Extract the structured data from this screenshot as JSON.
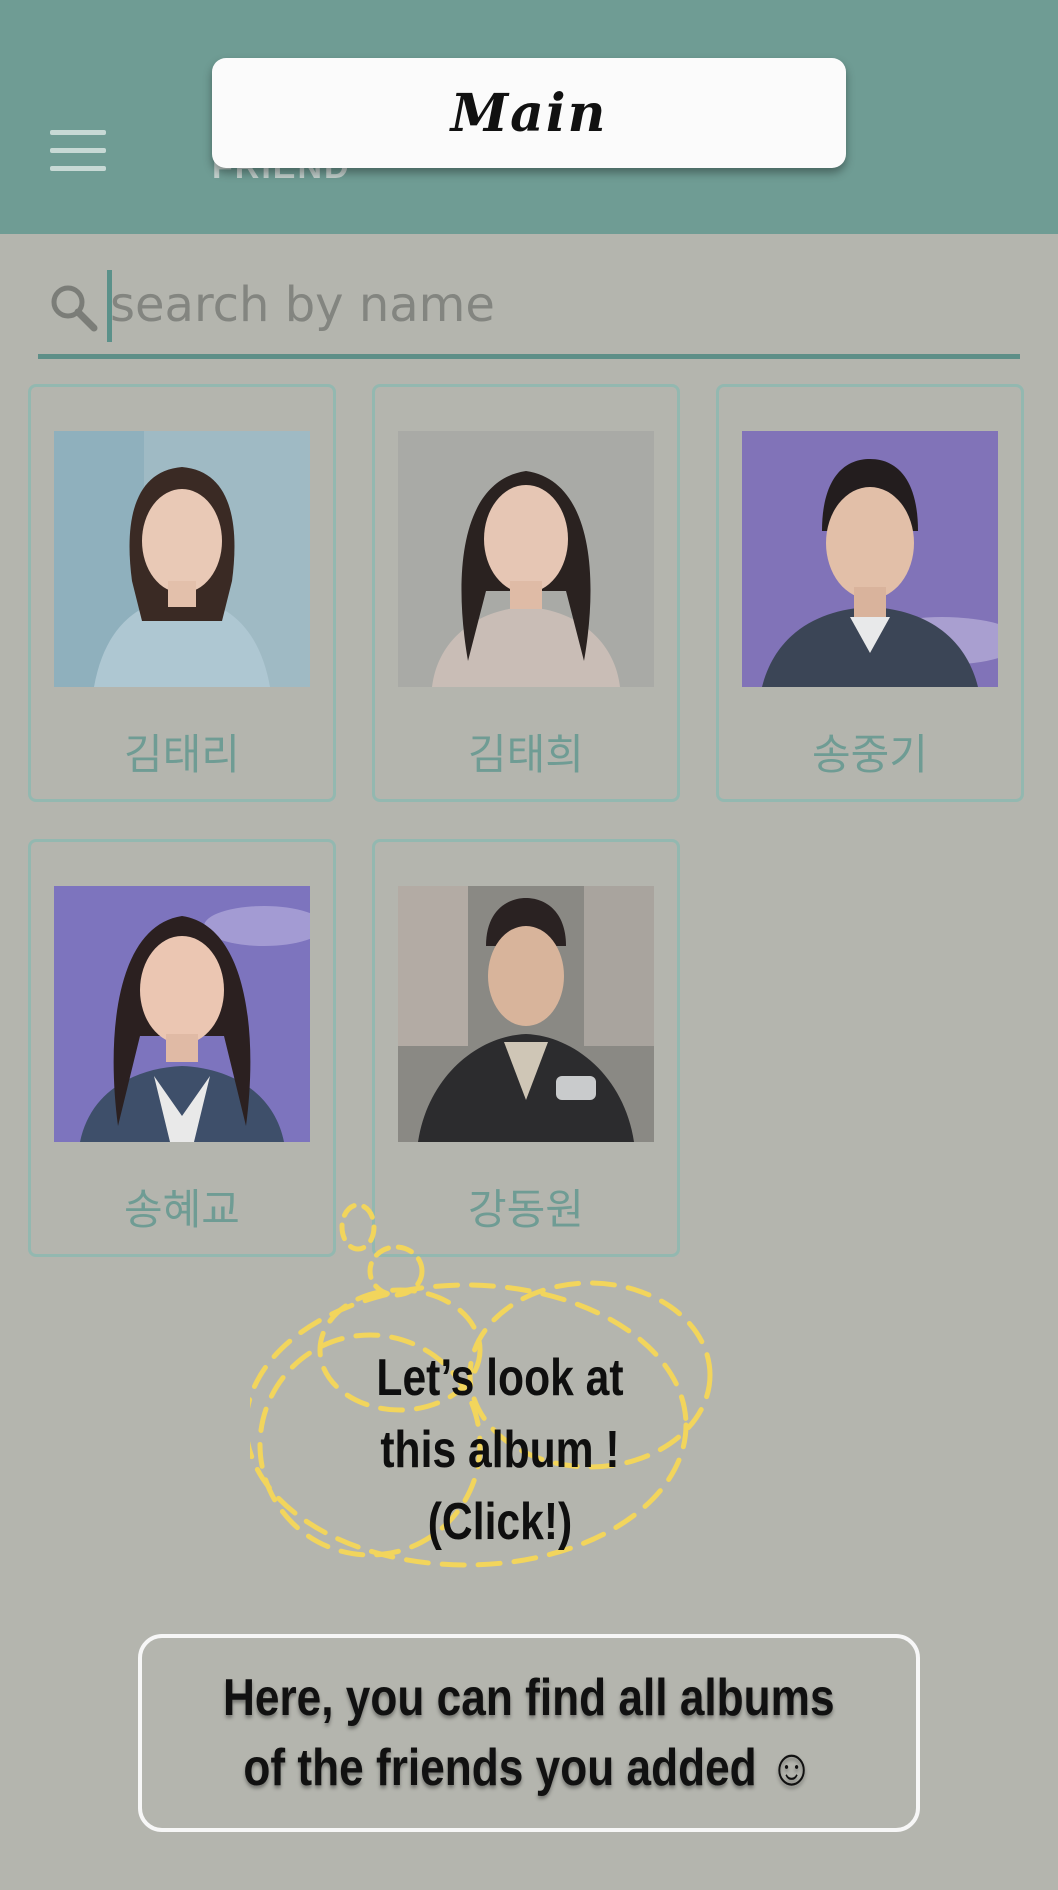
{
  "app_bar": {
    "title": "FRIEND",
    "menu_icon": "hamburger-menu-icon",
    "background": "#6f9c94"
  },
  "overlay_title": "Main",
  "search": {
    "placeholder": "search by name",
    "value": "",
    "icon": "search-icon"
  },
  "friends": [
    {
      "name": "김태리"
    },
    {
      "name": "김태희"
    },
    {
      "name": "송중기"
    },
    {
      "name": "송혜교"
    },
    {
      "name": "강동원"
    }
  ],
  "tip_bubble": {
    "text": "Let’s look at this album ! (Click!)",
    "line1": "Let’s look at",
    "line2": "this album !",
    "line3": "(Click!)",
    "border_color": "#f2d55c"
  },
  "banner": {
    "text": "Here, you can find all albums\nof the friends you added ☺"
  },
  "colors": {
    "accent": "#6f9c94",
    "dim_overlay": "#b4b5ae",
    "card_border": "#93b8b0"
  }
}
